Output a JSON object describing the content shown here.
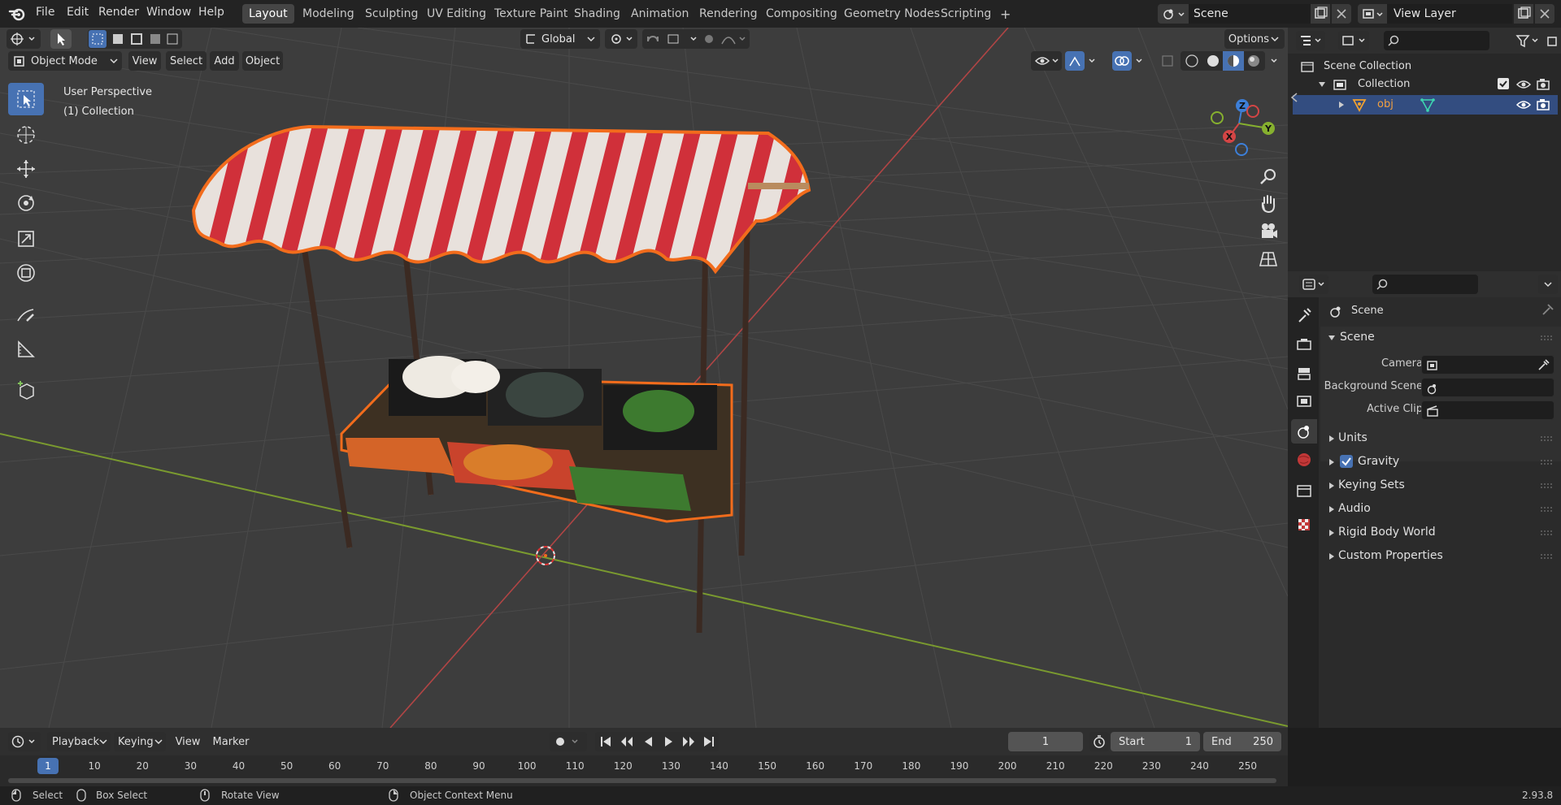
{
  "menubar": {
    "items": [
      "File",
      "Edit",
      "Render",
      "Window",
      "Help"
    ],
    "workspaces": [
      "Layout",
      "Modeling",
      "Sculpting",
      "UV Editing",
      "Texture Paint",
      "Shading",
      "Animation",
      "Rendering",
      "Compositing",
      "Geometry Nodes",
      "Scripting"
    ],
    "active_workspace": "Layout",
    "add_tab": "+",
    "scene_name": "Scene",
    "view_layer": "View Layer"
  },
  "viewport": {
    "transform_orientation": "Global",
    "options_label": "Options",
    "mode": "Object Mode",
    "menus": [
      "View",
      "Select",
      "Add",
      "Object"
    ],
    "overlay_title": "User Perspective",
    "overlay_collection": "(1) Collection",
    "gizmo_axes": {
      "x": "X",
      "y": "Y",
      "z": "Z"
    }
  },
  "outliner": {
    "root": "Scene Collection",
    "collection": "Collection",
    "object": "obj"
  },
  "properties": {
    "context": "Scene",
    "panel": "Scene",
    "fields": [
      {
        "label": "Camera",
        "value": ""
      },
      {
        "label": "Background Scene",
        "value": ""
      },
      {
        "label": "Active Clip",
        "value": ""
      }
    ],
    "subpanels": [
      "Units",
      "Gravity",
      "Keying Sets",
      "Audio",
      "Rigid Body World",
      "Custom Properties"
    ],
    "gravity_checked": true
  },
  "timeline": {
    "menus": [
      "Playback",
      "Keying",
      "View",
      "Marker"
    ],
    "current_frame": "1",
    "start_label": "Start",
    "start": "1",
    "end_label": "End",
    "end": "250",
    "ruler": [
      "1",
      "10",
      "20",
      "30",
      "40",
      "50",
      "60",
      "70",
      "80",
      "90",
      "100",
      "110",
      "120",
      "130",
      "140",
      "150",
      "160",
      "170",
      "180",
      "190",
      "200",
      "210",
      "220",
      "230",
      "240",
      "250"
    ]
  },
  "statusbar": {
    "hints": [
      "Select",
      "Box Select",
      "Rotate View",
      "Object Context Menu"
    ],
    "version": "2.93.8"
  },
  "colors": {
    "accent": "#4772b3",
    "selection_outline": "#f26c1c",
    "x_axis": "#d34545",
    "y_axis": "#86b02f",
    "z_axis": "#3d7fd8"
  }
}
